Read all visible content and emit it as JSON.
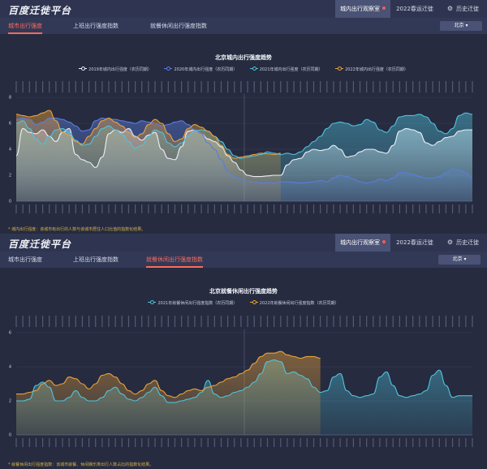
{
  "panel1": {
    "logo": "百度迁徙平台",
    "nav": [
      "城内出行观察室",
      "2022春运迁徙",
      "历史迁徙"
    ],
    "tabs": [
      "城市出行强度",
      "上班出行强度指数",
      "就餐休闲出行强度指数"
    ],
    "active_tab": 0,
    "city": "北京 ▾",
    "footnote": "* 城内出行强度：该城市有出行的人数与该城市居住人口比值的指数化结果。"
  },
  "panel2": {
    "logo": "百度迁徙平台",
    "nav": [
      "城内出行观察室",
      "2022春运迁徙",
      "历史迁徙"
    ],
    "tabs": [
      "城市出行强度",
      "上班出行强度指数",
      "就餐休闲出行强度指数"
    ],
    "active_tab": 2,
    "city": "北京 ▾",
    "footnote": "* 就餐休闲出行强度指数：该城市就餐、休闲娱乐类出行人数占比的指数化结果。"
  },
  "colors": {
    "background": "#262b3f",
    "active_tab": "#ff6a5a",
    "footnote": "#d8b24a",
    "s2019": "#eceff6",
    "s2020": "#5a7de0",
    "s2021": "#4fc2dc",
    "s2022": "#e9a23b"
  },
  "chart_data": [
    {
      "type": "area",
      "title": "北京城内出行强度趋势",
      "ylim": [
        0,
        8
      ],
      "yticks": [
        0,
        2,
        4,
        6,
        8
      ],
      "x_label_count": 70,
      "divider_fraction": 0.5,
      "series": [
        {
          "name": "2019年城内出行强度（农历同期）",
          "color": "#eceff6",
          "values": [
            3.5,
            5.6,
            5.3,
            5.2,
            5.5,
            5.0,
            4.6,
            5.3,
            5.6,
            3.6,
            3.2,
            3.0,
            2.6,
            3.4,
            5.2,
            5.5,
            5.3,
            5.6,
            5.0,
            4.7,
            5.1,
            5.3,
            4.0,
            3.3,
            3.2,
            4.2,
            5.4,
            5.5,
            5.2,
            4.8,
            4.6,
            4.2,
            3.5,
            3.0,
            2.4,
            2.0,
            1.9,
            1.9,
            1.95,
            2.0,
            2.0,
            2.8,
            3.2,
            3.3,
            3.8,
            4.0,
            3.9,
            4.0,
            4.3,
            4.0,
            3.4,
            3.5,
            3.8,
            4.0,
            4.0,
            3.8,
            3.7,
            4.3,
            5.4,
            5.6,
            5.5,
            5.3,
            4.5,
            4.3,
            4.6,
            4.9,
            5.0,
            5.4,
            5.5,
            5.5
          ]
        },
        {
          "name": "2020年城内出行强度（农历同期）",
          "color": "#5a7de0",
          "values": [
            6.3,
            6.4,
            6.3,
            5.9,
            6.1,
            6.4,
            6.4,
            6.3,
            6.1,
            5.8,
            5.4,
            5.5,
            6.2,
            6.4,
            6.3,
            6.3,
            6.2,
            6.1,
            6.0,
            6.2,
            6.1,
            6.0,
            5.8,
            5.9,
            6.1,
            6.2,
            5.9,
            5.5,
            5.2,
            4.5,
            4.0,
            3.2,
            2.3,
            1.9,
            1.7,
            1.55,
            1.5,
            1.4,
            1.45,
            1.4,
            1.5,
            1.5,
            1.45,
            1.4,
            1.45,
            1.5,
            1.6,
            1.5,
            1.8,
            2.0,
            1.9,
            1.7,
            1.5,
            1.4,
            1.5,
            1.7,
            1.6,
            1.8,
            2.2,
            2.2,
            2.1,
            1.9,
            1.8,
            1.8,
            1.9,
            2.2,
            2.5,
            2.4,
            2.2,
            1.8
          ]
        },
        {
          "name": "2021年城内出行强度（农历同期）",
          "color": "#4fc2dc",
          "values": [
            6.0,
            6.2,
            5.6,
            4.8,
            4.4,
            5.0,
            5.5,
            5.6,
            5.3,
            4.7,
            4.3,
            4.4,
            5.0,
            5.6,
            5.8,
            5.5,
            5.2,
            4.6,
            4.1,
            4.3,
            5.0,
            5.5,
            5.3,
            4.5,
            4.2,
            4.5,
            5.0,
            5.4,
            5.5,
            5.4,
            5.0,
            4.6,
            4.0,
            3.5,
            3.3,
            3.4,
            3.5,
            3.6,
            3.8,
            3.7,
            3.6,
            3.7,
            3.6,
            3.8,
            4.2,
            4.6,
            5.0,
            5.6,
            6.0,
            6.1,
            6.0,
            5.8,
            5.9,
            6.3,
            6.1,
            5.5,
            5.3,
            5.8,
            6.5,
            6.6,
            6.6,
            6.7,
            6.5,
            6.0,
            5.4,
            5.2,
            5.6,
            6.6,
            6.8,
            6.7
          ]
        },
        {
          "name": "2022年城内出行强度（农历同期）",
          "color": "#e9a23b",
          "values": [
            6.7,
            6.6,
            6.5,
            6.6,
            6.8,
            7.0,
            6.2,
            5.3,
            5.1,
            4.6,
            4.4,
            5.0,
            5.6,
            6.2,
            6.4,
            6.1,
            5.8,
            5.3,
            4.9,
            5.2,
            5.9,
            6.3,
            6.0,
            5.2,
            4.6,
            4.8,
            5.6,
            5.9,
            5.7,
            5.4,
            5.0,
            4.3,
            3.6,
            3.3,
            3.4,
            3.5,
            3.6,
            3.7,
            3.65,
            3.6,
            3.7
          ]
        }
      ]
    },
    {
      "type": "area",
      "title": "北京就餐休闲出行强度趋势",
      "ylim": [
        0,
        6
      ],
      "yticks": [
        0,
        2,
        4,
        6
      ],
      "x_label_count": 70,
      "divider_fraction": 0.5,
      "series": [
        {
          "name": "2021年就餐休闲出行强度指数（农历同期）",
          "color": "#4fc2dc",
          "values": [
            2.0,
            2.0,
            2.1,
            2.9,
            3.1,
            2.8,
            2.0,
            2.0,
            2.2,
            2.6,
            2.2,
            2.0,
            2.0,
            2.2,
            2.6,
            2.8,
            2.4,
            2.1,
            2.0,
            2.2,
            2.5,
            2.8,
            2.3,
            1.9,
            1.9,
            2.0,
            2.1,
            2.2,
            2.5,
            3.2,
            2.4,
            2.2,
            2.3,
            2.5,
            2.6,
            2.8,
            3.1,
            3.6,
            4.3,
            4.4,
            4.3,
            3.6,
            3.7,
            3.5,
            3.3,
            2.8,
            2.5,
            2.6,
            3.4,
            3.6,
            2.6,
            2.3,
            2.2,
            2.3,
            2.4,
            3.4,
            3.7,
            2.9,
            2.3,
            2.2,
            2.3,
            2.4,
            2.6,
            3.5,
            3.8,
            2.9,
            2.2,
            2.3,
            2.3,
            2.3
          ]
        },
        {
          "name": "2022年就餐休闲出行强度指数（农历同期）",
          "color": "#e9a23b",
          "values": [
            2.4,
            2.4,
            2.5,
            2.6,
            3.0,
            3.2,
            2.9,
            3.0,
            3.4,
            3.3,
            3.0,
            2.7,
            3.0,
            3.5,
            3.6,
            3.4,
            3.0,
            2.6,
            2.4,
            2.6,
            3.0,
            3.2,
            2.6,
            2.3,
            2.2,
            2.4,
            2.6,
            2.7,
            2.6,
            2.8,
            2.9,
            3.1,
            3.3,
            3.4,
            3.6,
            3.8,
            4.2,
            4.6,
            4.8,
            4.8,
            4.9,
            4.7,
            4.6,
            4.5,
            4.6,
            4.6,
            4.5
          ]
        }
      ]
    }
  ]
}
